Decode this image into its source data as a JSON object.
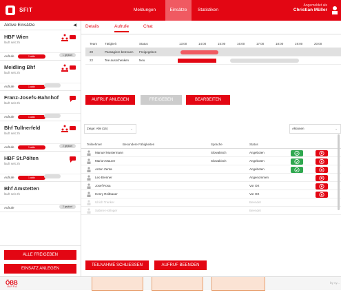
{
  "app": {
    "name": "SFIT"
  },
  "nav": {
    "items": [
      "Meldungen",
      "Einsätze",
      "Statistiken"
    ],
    "active": "Einsätze"
  },
  "user": {
    "line1": "Angemeldet als",
    "line2": "Christian Müller"
  },
  "sidebar": {
    "title": "Aktive Einsätze",
    "cards": [
      {
        "name": "HBF Wien",
        "sub": "läuft seit 2h",
        "row_label": "Aufrufe",
        "red_pill": "1 aktiv",
        "grey_pill": "1 geplant"
      },
      {
        "name": "Meidling Bhf",
        "sub": "läuft seit 2h",
        "row_label": "Aufrufe",
        "red_pill": "1 aktiv",
        "grey_pill": ""
      },
      {
        "name": "Franz-Josefs-Bahnhof",
        "sub": "läuft seit 2h",
        "row_label": "Aufrufe",
        "red_pill": "1 aktiv",
        "grey_pill": ""
      },
      {
        "name": "Bhf Tullnerfeld",
        "sub": "läuft seit 2h",
        "row_label": "Aufrufe",
        "red_pill": "1 aktiv",
        "grey_pill": "2 geplant"
      },
      {
        "name": "HBF St.Pölten",
        "sub": "läuft seit 2h",
        "row_label": "Aufrufe",
        "red_pill": "1 aktiv",
        "grey_pill": ""
      },
      {
        "name": "Bhf Amstetten",
        "sub": "läuft seit 2h",
        "row_label": "Aufrufe",
        "red_pill": "",
        "grey_pill": "2 geplant"
      }
    ],
    "btn_release_all": "ALLE FREIGEBEN",
    "btn_create": "EINSATZ ANLEGEN"
  },
  "tabs": [
    "Details",
    "Aufrufe",
    "Chat"
  ],
  "gantt": {
    "headers": {
      "team": "Team",
      "task": "Tätigkeit",
      "status": "Status"
    },
    "times": [
      "13:00",
      "14:00",
      "15:00",
      "16:00",
      "17:00",
      "18:00",
      "19:00",
      "20:00"
    ],
    "rows": [
      {
        "team": "20",
        "task": "Passagiere betreuen",
        "status": "Freigegeben"
      },
      {
        "team": "22",
        "task": "Tee ausschenken",
        "status": "Neu"
      }
    ]
  },
  "actions": {
    "create": "AUFRUF ANLEGEN",
    "release": "FREIGEBEN",
    "edit": "BEARBEITEN"
  },
  "filter": {
    "show": "Zeige: Alle (16)",
    "actions": "Aktionen"
  },
  "participants": {
    "headers": {
      "name": "Teilnehmer",
      "skills": "Besondere Fähigkeiten",
      "lang": "Sprache",
      "status": "Status"
    },
    "rows": [
      {
        "name": "Manuel Mustermann",
        "lang": "Slowakisch",
        "status": "Angeboten"
      },
      {
        "name": "Marion Maurer",
        "lang": "Slowakisch",
        "status": "Angeboten"
      },
      {
        "name": "Anton Zenta",
        "lang": "",
        "status": "Angeboten"
      },
      {
        "name": "Leo Brenner",
        "lang": "",
        "status": "Angenommen"
      },
      {
        "name": "Josef Rosa",
        "lang": "",
        "status": "Vor Ort"
      },
      {
        "name": "Henry Reitbauer",
        "lang": "",
        "status": "Vor Ort"
      },
      {
        "name": "Ulrich Trenker",
        "lang": "",
        "status": "Beendet"
      },
      {
        "name": "Sabine Hofinger",
        "lang": "",
        "status": "Beendet"
      }
    ]
  },
  "bottom": {
    "close": "TEILNAHME SCHLIESSEN",
    "end": "AUFRUF BEENDEN"
  },
  "footer": {
    "brand": "ÖBB",
    "sub": "INFRA",
    "credit": "by cy..."
  },
  "colors": {
    "brand_red": "#e30613",
    "ok_green": "#2fa84f"
  }
}
